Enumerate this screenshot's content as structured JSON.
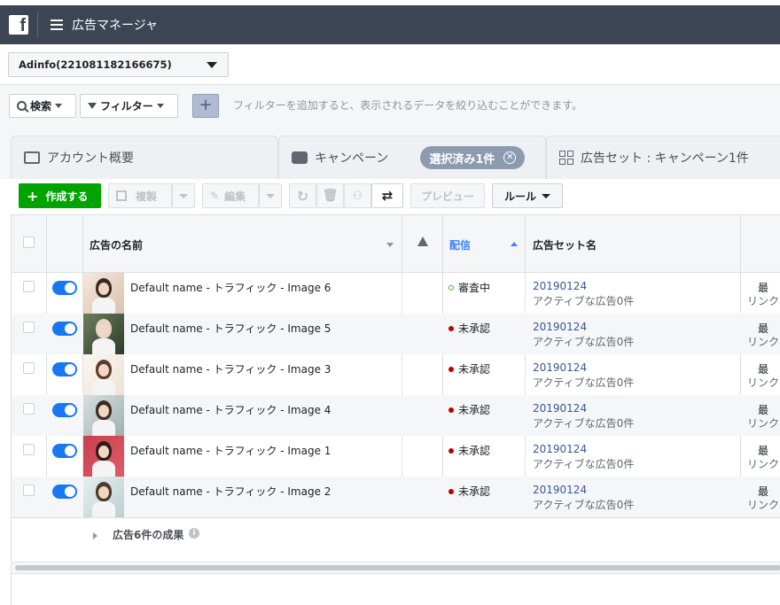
{
  "app": {
    "title": "広告マネージャ"
  },
  "account": {
    "selected": "Adinfo(221081182166675)"
  },
  "filters": {
    "search_label": "検索",
    "filter_label": "フィルター",
    "add_label": "+",
    "hint": "フィルターを追加すると、表示されるデータを絞り込むことができます。"
  },
  "tabs": {
    "account": "アカウント概要",
    "campaign": "キャンペーン",
    "selected_badge": "選択済み1件",
    "adset": "広告セット : キャンペーン1件"
  },
  "toolbar": {
    "create": "作成する",
    "duplicate": "複製",
    "edit": "編集",
    "preview": "プレビュー",
    "rules": "ルール"
  },
  "table": {
    "headers": {
      "name": "広告の名前",
      "delivery": "配信",
      "adset_name": "広告セット名"
    },
    "rows": [
      {
        "name": "Default name - トラフィック - Image 6",
        "status": "審査中",
        "status_color": "#42b72a",
        "adset": "20190124",
        "adset_sub": "アクティブな広告0件",
        "clip": "最",
        "clip_sub": "リンクの"
      },
      {
        "name": "Default name - トラフィック - Image 5",
        "status": "未承認",
        "status_color": "#bb0000",
        "adset": "20190124",
        "adset_sub": "アクティブな広告0件",
        "clip": "最",
        "clip_sub": "リンクの"
      },
      {
        "name": "Default name - トラフィック - Image 3",
        "status": "未承認",
        "status_color": "#bb0000",
        "adset": "20190124",
        "adset_sub": "アクティブな広告0件",
        "clip": "最",
        "clip_sub": "リンクの"
      },
      {
        "name": "Default name - トラフィック - Image 4",
        "status": "未承認",
        "status_color": "#bb0000",
        "adset": "20190124",
        "adset_sub": "アクティブな広告0件",
        "clip": "最",
        "clip_sub": "リンクの"
      },
      {
        "name": "Default name - トラフィック - Image 1",
        "status": "未承認",
        "status_color": "#bb0000",
        "adset": "20190124",
        "adset_sub": "アクティブな広告0件",
        "clip": "最",
        "clip_sub": "リンクの"
      },
      {
        "name": "Default name - トラフィック - Image 2",
        "status": "未承認",
        "status_color": "#bb0000",
        "adset": "20190124",
        "adset_sub": "アクティブな広告0件",
        "clip": "最",
        "clip_sub": "リンクの"
      }
    ],
    "summary": "広告6件の成果"
  }
}
